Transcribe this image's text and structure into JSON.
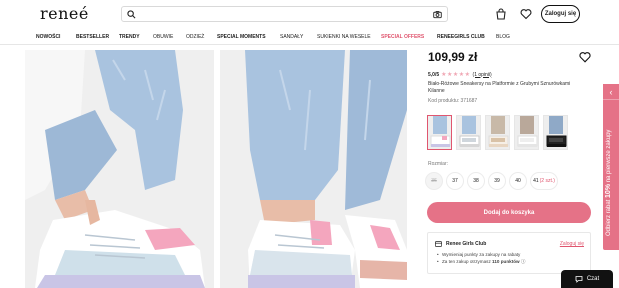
{
  "header": {
    "logo": "reneé",
    "search_placeholder": "",
    "login_label": "Zaloguj się"
  },
  "nav": {
    "items": [
      "NOWOŚCI",
      "BESTSELLER",
      "TRENDY",
      "OBUWIE",
      "ODZIEŻ",
      "SPECIAL MOMENTS",
      "SANDAŁY",
      "SUKIENKI NA WESELE",
      "SPECIAL OFFERS",
      "RENEEGIRLS CLUB",
      "BLOG"
    ]
  },
  "product": {
    "price": "109,99 zł",
    "rating": "5,0/5",
    "stars": "★★★★★",
    "reviews": "(1 opinii)",
    "name": "Biało-Różowe Sneakersy na Platformie z Grubymi Sznurówkami Kilanne",
    "code": "Kod produktu: 371687",
    "size_label": "Rozmiar:",
    "sizes": [
      "36",
      "37",
      "38",
      "39",
      "40",
      "41"
    ],
    "size_41_note": "(2 szt.)",
    "cart_label": "Dodaj do koszyka"
  },
  "club": {
    "title": "Renee Girls Club",
    "link": "Zaloguj się",
    "benefit_1": "Wymieniaj punkty za zakupy na rabaty",
    "benefit_2_prefix": "Za ten zakup otrzymasz",
    "benefit_2_points": "110 punktów"
  },
  "side_tab": {
    "prefix": "Odbierz rabat",
    "percent": "10%",
    "suffix": "na pierwsze zakupy"
  },
  "chat": {
    "label": "Czat"
  },
  "colors": {
    "accent": "#e57287",
    "accent_text": "#e0566f",
    "dark": "#111111"
  }
}
